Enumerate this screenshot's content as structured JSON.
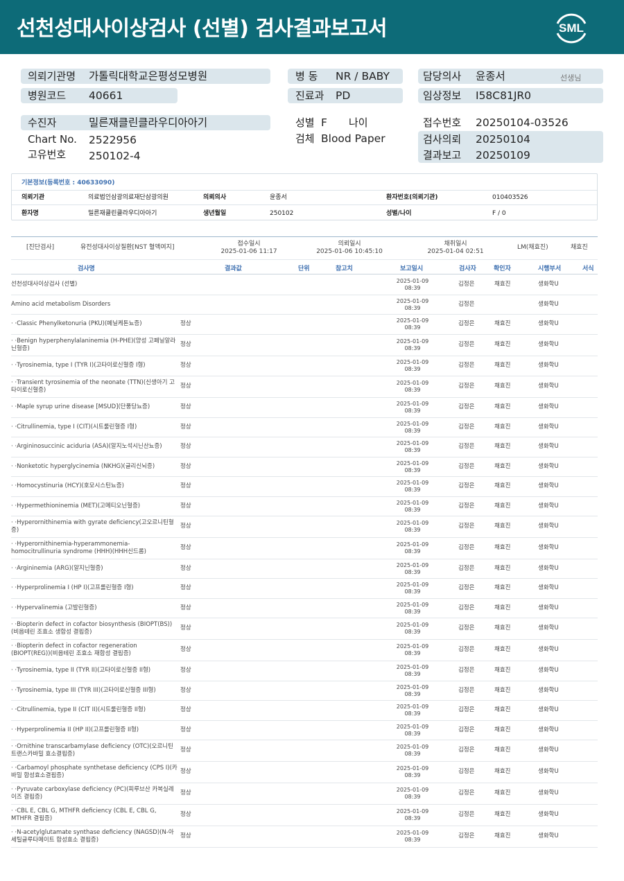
{
  "header": {
    "title": "선천성대사이상검사 (선별) 검사결과보고서",
    "logo_text": "SML"
  },
  "patient": {
    "institution_label": "의뢰기관명",
    "institution": "가톨릭대학교은평성모병원",
    "hospital_code_label": "병원코드",
    "hospital_code": "40661",
    "ward_label": "병 동",
    "ward": "NR / BABY",
    "dept_label": "진료과",
    "dept": "PD",
    "doctor_label": "담당의사",
    "doctor": "윤종서",
    "doctor_suffix": "선생님",
    "clinical_label": "임상정보",
    "clinical": "I58C81JR0",
    "recipient_label": "수진자",
    "recipient": "밀른재클린클라우디아아기",
    "chart_label": "Chart No.",
    "chart": "2522956",
    "unique_label": "고유번호",
    "unique": "250102-4",
    "sex_label": "성별",
    "sex": "F",
    "age_label": "나이",
    "specimen_label": "검체",
    "specimen": "Blood Paper",
    "reception_label": "접수번호",
    "reception": "20250104-03526",
    "request_label": "검사의뢰",
    "request": "20250104",
    "report_label": "결과보고",
    "report": "20250109"
  },
  "basic_info": {
    "title": "기본정보(등록번호 : 40633090)",
    "inst_label": "의뢰기관",
    "inst": "의료법인삼광의료재단삼광의원",
    "doc_label": "의뢰의사",
    "doc": "윤종서",
    "pno_label": "환자번호(의뢰기관)",
    "pno": "010403526",
    "name_label": "환자명",
    "name": "밀른재클린클라우디아아기",
    "birth_label": "생년월일",
    "birth": "250102",
    "sexage_label": "성별/나이",
    "sexage": "F / 0"
  },
  "section": {
    "type": "[진단검사]",
    "exam": "유전성대사이상질환[NST 혈액여지]",
    "recv_label": "접수일시",
    "recv": "2025-01-06 11:17",
    "req_label": "의뢰일시",
    "req": "2025-01-06 10:45:10",
    "col_label": "채취일시",
    "col": "2025-01-04 02:51",
    "lm": "LM(채효진)",
    "lm_name": "채효진"
  },
  "columns": [
    "검사명",
    "결과값",
    "단위",
    "참고치",
    "보고일시",
    "검사자",
    "확인자",
    "시행부서",
    "서식"
  ],
  "rows": [
    {
      "name": "선천성대사이상검사 (선별)",
      "result": "",
      "date": "2025-01-09 08:39",
      "tester": "김정은",
      "confirmer": "채효진",
      "dept": "생화학U"
    },
    {
      "name": "  Amino acid metabolism Disorders",
      "result": "",
      "date": "2025-01-09 08:39",
      "tester": "김정은",
      "confirmer": "",
      "dept": "생화학U"
    },
    {
      "name": "  · ·Classic Phenylketonuria (PKU)(페닐케톤뇨증)",
      "result": "정상",
      "date": "2025-01-09 08:39",
      "tester": "김정은",
      "confirmer": "채효진",
      "dept": "생화학U"
    },
    {
      "name": "  · ·Benign hyperphenylalaninemia (H-PHE)(양성 고페닐알라닌혈증)",
      "result": "정상",
      "date": "2025-01-09 08:39",
      "tester": "김정은",
      "confirmer": "채효진",
      "dept": "생화학U"
    },
    {
      "name": "  · ·Tyrosinemia, type I (TYR I)(고타이로신혈증 I형)",
      "result": "정상",
      "date": "2025-01-09 08:39",
      "tester": "김정은",
      "confirmer": "채효진",
      "dept": "생화학U"
    },
    {
      "name": "  · ·Transient tyrosinemia of the neonate (TTN)(신생아기 고타이로신혈증)",
      "result": "정상",
      "date": "2025-01-09 08:39",
      "tester": "김정은",
      "confirmer": "채효진",
      "dept": "생화학U"
    },
    {
      "name": "  · ·Maple syrup urine disease [MSUD](단풍당뇨증)",
      "result": "정상",
      "date": "2025-01-09 08:39",
      "tester": "김정은",
      "confirmer": "채효진",
      "dept": "생화학U"
    },
    {
      "name": "  · ·Citrullinemia, type I (CIT)(시트룰린혈증 I형)",
      "result": "정상",
      "date": "2025-01-09 08:39",
      "tester": "김정은",
      "confirmer": "채효진",
      "dept": "생화학U"
    },
    {
      "name": "  · ·Argininosuccinic aciduria (ASA)(알지노석시닌산뇨증)",
      "result": "정상",
      "date": "2025-01-09 08:39",
      "tester": "김정은",
      "confirmer": "채효진",
      "dept": "생화학U"
    },
    {
      "name": "  · ·Nonketotic hyperglycinemia (NKHG)(글리신뇌증)",
      "result": "정상",
      "date": "2025-01-09 08:39",
      "tester": "김정은",
      "confirmer": "채효진",
      "dept": "생화학U"
    },
    {
      "name": "  · ·Homocystinuria (HCY)(호모시스틴뇨증)",
      "result": "정상",
      "date": "2025-01-09 08:39",
      "tester": "김정은",
      "confirmer": "채효진",
      "dept": "생화학U"
    },
    {
      "name": "  · ·Hypermethioninemia (MET)(고메티오닌혈증)",
      "result": "정상",
      "date": "2025-01-09 08:39",
      "tester": "김정은",
      "confirmer": "채효진",
      "dept": "생화학U"
    },
    {
      "name": "  · ·Hyperornithinemia with gyrate deficiency(고오르니틴혈증)",
      "result": "정상",
      "date": "2025-01-09 08:39",
      "tester": "김정은",
      "confirmer": "채효진",
      "dept": "생화학U"
    },
    {
      "name": "  · ·Hyperornithinemia-hyperammonemia-homocitrullinuria syndrome (HHH)(HHH신드롬)",
      "result": "정상",
      "date": "2025-01-09 08:39",
      "tester": "김정은",
      "confirmer": "채효진",
      "dept": "생화학U"
    },
    {
      "name": "  · ·Argininemia (ARG)(알지닌혈증)",
      "result": "정상",
      "date": "2025-01-09 08:39",
      "tester": "김정은",
      "confirmer": "채효진",
      "dept": "생화학U"
    },
    {
      "name": "  · ·Hyperprolinemia I (HP I)(고프롤린혈증 I형)",
      "result": "정상",
      "date": "2025-01-09 08:39",
      "tester": "김정은",
      "confirmer": "채효진",
      "dept": "생화학U"
    },
    {
      "name": "  · ·Hypervalinemia (고발린혈증)",
      "result": "정상",
      "date": "2025-01-09 08:39",
      "tester": "김정은",
      "confirmer": "채효진",
      "dept": "생화학U"
    },
    {
      "name": "  · ·Biopterin defect in cofactor biosynthesis (BIOPT(BS))(비옵테린 조효소 생합성 결핍증)",
      "result": "정상",
      "date": "2025-01-09 08:39",
      "tester": "김정은",
      "confirmer": "채효진",
      "dept": "생화학U"
    },
    {
      "name": "  · ·Biopterin defect in cofactor regeneration (BIOPT(REG))(비옵테린 조효소 재합성 결핍증)",
      "result": "정상",
      "date": "2025-01-09 08:39",
      "tester": "김정은",
      "confirmer": "채효진",
      "dept": "생화학U"
    },
    {
      "name": "  · ·Tyrosinemia, type II (TYR II)(고타이로신혈증 II형)",
      "result": "정상",
      "date": "2025-01-09 08:39",
      "tester": "김정은",
      "confirmer": "채효진",
      "dept": "생화학U"
    },
    {
      "name": "  · ·Tyrosinemia, type III (TYR III)(고타이로신혈증 III형)",
      "result": "정상",
      "date": "2025-01-09 08:39",
      "tester": "김정은",
      "confirmer": "채효진",
      "dept": "생화학U"
    },
    {
      "name": "  · ·Citrullinemia, type II (CIT II)(시트룰린혈증 II형)",
      "result": "정상",
      "date": "2025-01-09 08:39",
      "tester": "김정은",
      "confirmer": "채효진",
      "dept": "생화학U"
    },
    {
      "name": "  · ·Hyperprolinemia II (HP II)(고프롤린혈증 II형)",
      "result": "정상",
      "date": "2025-01-09 08:39",
      "tester": "김정은",
      "confirmer": "채효진",
      "dept": "생화학U"
    },
    {
      "name": "  · ·Ornithine transcarbamylase deficiency (OTC)(오르니틴 트랜스카바밀 효소결핍증)",
      "result": "정상",
      "date": "2025-01-09 08:39",
      "tester": "김정은",
      "confirmer": "채효진",
      "dept": "생화학U"
    },
    {
      "name": "  · ·Carbamoyl phosphate synthetase deficiency (CPS I)(카바밀 합성효소결핍증)",
      "result": "정상",
      "date": "2025-01-09 08:39",
      "tester": "김정은",
      "confirmer": "채효진",
      "dept": "생화학U"
    },
    {
      "name": "  · ·Pyruvate carboxylase deficiency (PC)(피루브산 카복실레이즈 결핍증)",
      "result": "정상",
      "date": "2025-01-09 08:39",
      "tester": "김정은",
      "confirmer": "채효진",
      "dept": "생화학U"
    },
    {
      "name": "  · ·CBL E, CBL G, MTHFR deficiency (CBL E, CBL G, MTHFR 결핍증)",
      "result": "정상",
      "date": "2025-01-09 08:39",
      "tester": "김정은",
      "confirmer": "채효진",
      "dept": "생화학U"
    },
    {
      "name": "  · ·N-acetylglutamate synthase deficiency (NAGSD)(N-아세틸글루타메이트 합성효소 결핍증)",
      "result": "정상",
      "date": "2025-01-09 08:39",
      "tester": "김정은",
      "confirmer": "채효진",
      "dept": "생화학U"
    }
  ]
}
